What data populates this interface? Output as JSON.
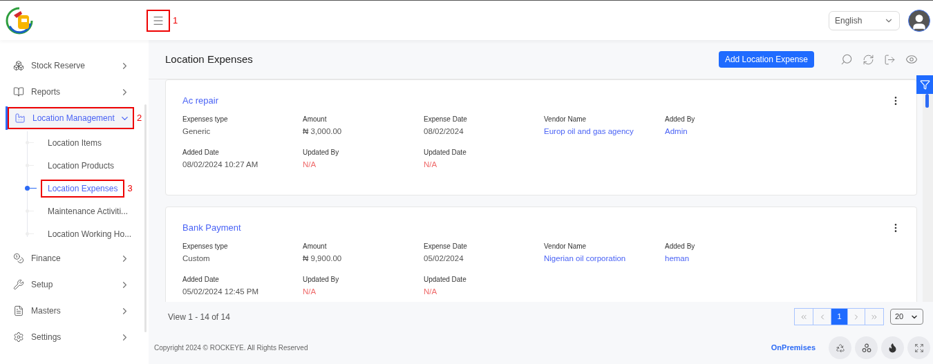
{
  "header": {
    "menu_annotation": "1",
    "language": "English"
  },
  "sidebar": {
    "items": [
      {
        "label": "Stock Reserve",
        "expanded": false,
        "selected": false
      },
      {
        "label": "Reports",
        "expanded": false,
        "selected": false
      },
      {
        "label": "Location Management",
        "expanded": true,
        "selected": true,
        "annotation": "2",
        "children": [
          {
            "label": "Location Items",
            "selected": false
          },
          {
            "label": "Location Products",
            "selected": false
          },
          {
            "label": "Location Expenses",
            "selected": true,
            "annotation": "3"
          },
          {
            "label": "Maintenance Activiti...",
            "selected": false
          },
          {
            "label": "Location Working Ho...",
            "selected": false
          }
        ]
      },
      {
        "label": "Finance",
        "expanded": false,
        "selected": false
      },
      {
        "label": "Setup",
        "expanded": false,
        "selected": false
      },
      {
        "label": "Masters",
        "expanded": false,
        "selected": false
      },
      {
        "label": "Settings",
        "expanded": false,
        "selected": false
      }
    ]
  },
  "page": {
    "title": "Location Expenses",
    "add_button": "Add Location Expense"
  },
  "cards": [
    {
      "title": "Ac repair",
      "fields": [
        {
          "label": "Expenses type",
          "value": "Generic",
          "kind": "text"
        },
        {
          "label": "Amount",
          "value": "₦ 3,000.00",
          "kind": "text"
        },
        {
          "label": "Expense Date",
          "value": "08/02/2024",
          "kind": "text"
        },
        {
          "label": "Vendor Name",
          "value": "Europ oil and gas agency",
          "kind": "link"
        },
        {
          "label": "Added By",
          "value": "Admin",
          "kind": "link"
        },
        {
          "label": "Added Date",
          "value": "08/02/2024 10:27 AM",
          "kind": "text"
        },
        {
          "label": "Updated By",
          "value": "N/A",
          "kind": "missing"
        },
        {
          "label": "Updated Date",
          "value": "N/A",
          "kind": "missing"
        }
      ]
    },
    {
      "title": "Bank Payment",
      "fields": [
        {
          "label": "Expenses type",
          "value": "Custom",
          "kind": "text"
        },
        {
          "label": "Amount",
          "value": "₦ 9,900.00",
          "kind": "text"
        },
        {
          "label": "Expense Date",
          "value": "05/02/2024",
          "kind": "text"
        },
        {
          "label": "Vendor Name",
          "value": "Nigerian oil corporation",
          "kind": "link"
        },
        {
          "label": "Added By",
          "value": "heman",
          "kind": "link"
        },
        {
          "label": "Added Date",
          "value": "05/02/2024 12:45 PM",
          "kind": "text"
        },
        {
          "label": "Updated By",
          "value": "N/A",
          "kind": "missing"
        },
        {
          "label": "Updated Date",
          "value": "N/A",
          "kind": "missing"
        }
      ]
    }
  ],
  "pager": {
    "summary": "View 1 - 14 of 14",
    "pages": [
      {
        "label": "1",
        "selected": true
      }
    ],
    "page_size": "20"
  },
  "footer": {
    "copyright": "Copyright 2024 © ROCKEYE. All Rights Reserved",
    "mode": "OnPremises"
  }
}
